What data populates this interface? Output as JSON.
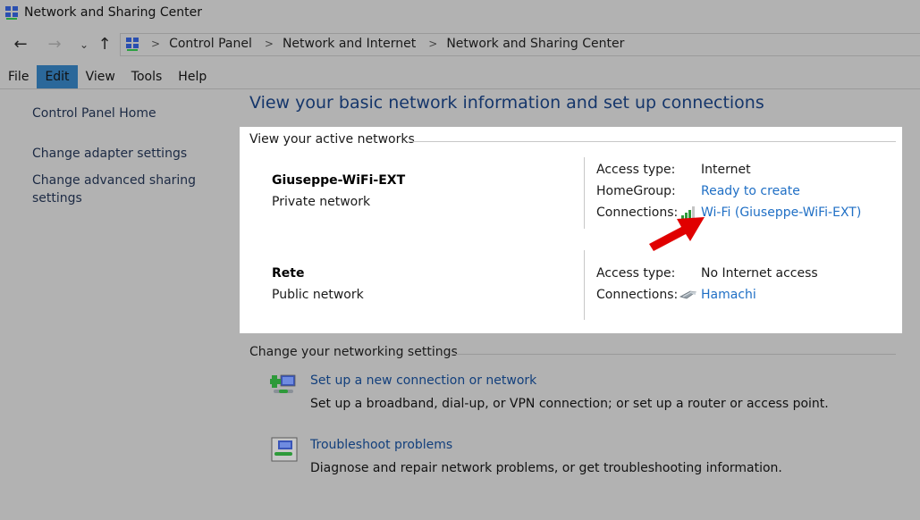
{
  "window": {
    "title": "Network and Sharing Center"
  },
  "nav": {
    "back_icon": "←",
    "forward_icon": "→",
    "recent_icon": "⌄",
    "up_icon": "↑"
  },
  "breadcrumb": {
    "separator": ">",
    "items": [
      "Control Panel",
      "Network and Internet",
      "Network and Sharing Center"
    ]
  },
  "menu": {
    "items": [
      "File",
      "Edit",
      "View",
      "Tools",
      "Help"
    ],
    "active": "Edit"
  },
  "sidebar": {
    "home": "Control Panel Home",
    "items": [
      "Change adapter settings",
      "Change advanced sharing settings"
    ]
  },
  "main": {
    "heading": "View your basic network information and set up connections",
    "active_networks": {
      "title": "View your active networks",
      "networks": [
        {
          "name": "Giuseppe-WiFi-EXT",
          "type": "Private network",
          "access_type_label": "Access type:",
          "access_type": "Internet",
          "homegroup_label": "HomeGroup:",
          "homegroup": "Ready to create",
          "connections_label": "Connections:",
          "connection_icon": "wifi-signal-icon",
          "connection": "Wi-Fi (Giuseppe-WiFi-EXT)"
        },
        {
          "name": "Rete",
          "type": "Public network",
          "access_type_label": "Access type:",
          "access_type": "No Internet access",
          "connections_label": "Connections:",
          "connection_icon": "ethernet-adapter-icon",
          "connection": "Hamachi"
        }
      ]
    },
    "settings": {
      "title": "Change your networking settings",
      "items": [
        {
          "icon": "new-connection-icon",
          "label": "Set up a new connection or network",
          "description": "Set up a broadband, dial-up, or VPN connection; or set up a router or access point."
        },
        {
          "icon": "troubleshoot-icon",
          "label": "Troubleshoot problems",
          "description": "Diagnose and repair network problems, or get troubleshooting information."
        }
      ]
    }
  },
  "annotation": {
    "arrow_color": "#e00000"
  }
}
